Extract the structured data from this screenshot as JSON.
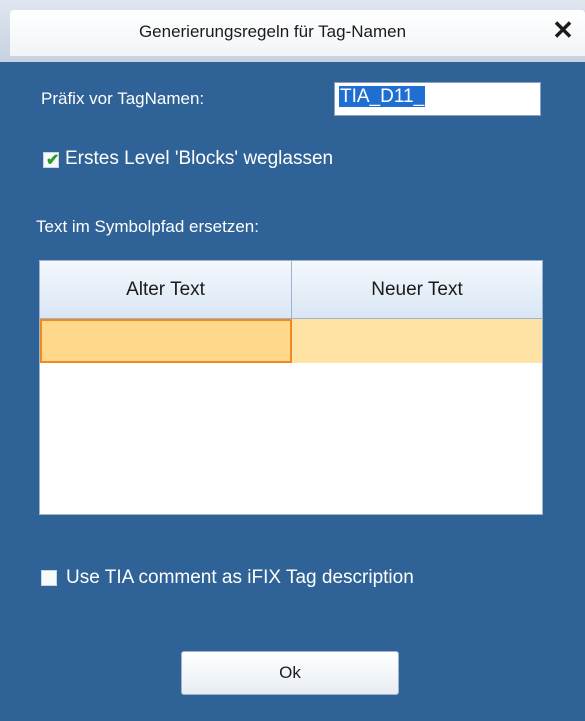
{
  "dialog": {
    "title": "Generierungsregeln für Tag-Namen",
    "close_icon": "close-icon"
  },
  "prefix": {
    "label": "Präfix vor TagNamen:",
    "value": "TIA_D11_"
  },
  "skip_blocks": {
    "label": "Erstes Level 'Blocks' weglassen",
    "checked": true
  },
  "replace_section": {
    "label": "Text im Symbolpfad ersetzen:",
    "columns": [
      "Alter Text",
      "Neuer Text"
    ],
    "rows": [
      [
        "",
        ""
      ]
    ]
  },
  "tia_comment": {
    "label": "Use TIA comment as iFIX Tag description",
    "checked": false
  },
  "ok_button": {
    "label": "Ok"
  },
  "colors": {
    "background": "#2f6296",
    "selected_row": "#ffe3a4",
    "active_cell_border": "#f08a1e",
    "check_mark": "#2a9b2a"
  }
}
